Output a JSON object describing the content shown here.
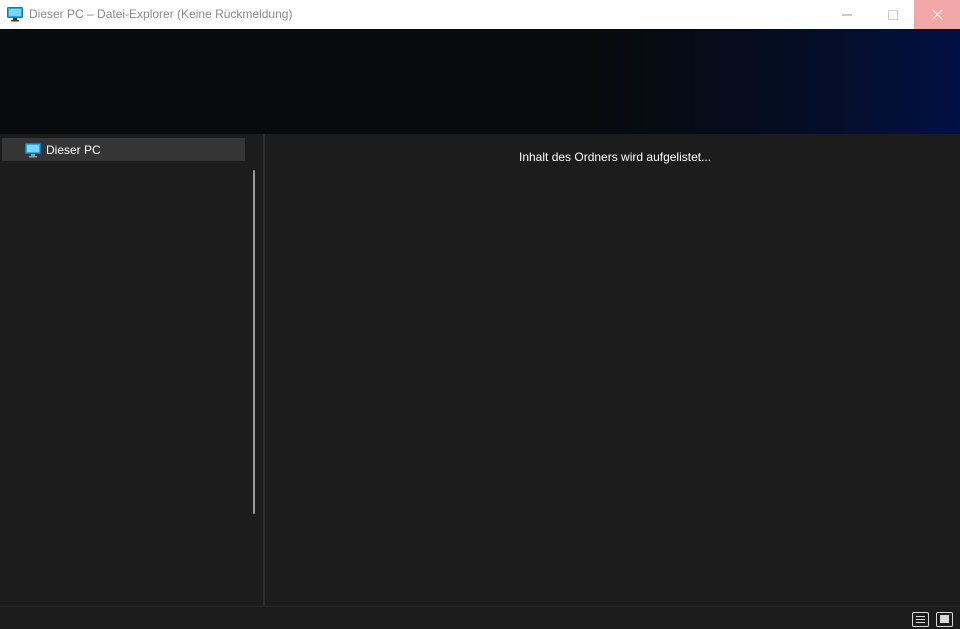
{
  "window": {
    "title": "Dieser PC – Datei-Explorer (Keine Rückmeldung)",
    "icon": "monitor-icon",
    "controls": {
      "minimize_icon": "minimize-icon",
      "maximize_icon": "maximize-icon",
      "close_icon": "close-icon",
      "close_hover_color": "#f1a7a7"
    }
  },
  "navigation": {
    "items": [
      {
        "label": "Dieser PC",
        "icon": "monitor-icon",
        "selected": true
      }
    ]
  },
  "content": {
    "status_message": "Inhalt des Ordners wird aufgelistet..."
  },
  "statusbar": {
    "view_buttons": [
      {
        "icon": "details-view-icon"
      },
      {
        "icon": "tiles-view-icon"
      }
    ]
  },
  "colors": {
    "background": "#1c1c1c",
    "selected_item": "#353535",
    "accent_blue": "#1aa0e0"
  }
}
